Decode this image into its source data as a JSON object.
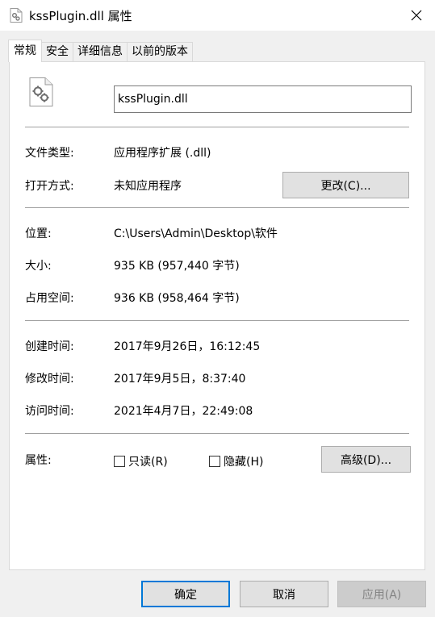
{
  "window": {
    "title": "kssPlugin.dll 属性",
    "icon": "dll-file-icon"
  },
  "tabs": [
    {
      "label": "常规",
      "active": true
    },
    {
      "label": "安全",
      "active": false
    },
    {
      "label": "详细信息",
      "active": false
    },
    {
      "label": "以前的版本",
      "active": false
    }
  ],
  "file": {
    "name": "kssPlugin.dll"
  },
  "fields": {
    "type_label": "文件类型:",
    "type_value": "应用程序扩展 (.dll)",
    "open_label": "打开方式:",
    "open_value": "未知应用程序",
    "change_button": "更改(C)...",
    "location_label": "位置:",
    "location_value": "C:\\Users\\Admin\\Desktop\\软件",
    "size_label": "大小:",
    "size_value": "935 KB (957,440 字节)",
    "disk_label": "占用空间:",
    "disk_value": "936 KB (958,464 字节)",
    "created_label": "创建时间:",
    "created_value": "2017年9月26日，16:12:45",
    "modified_label": "修改时间:",
    "modified_value": "2017年9月5日，8:37:40",
    "accessed_label": "访问时间:",
    "accessed_value": "2021年4月7日，22:49:08",
    "attr_label": "属性:",
    "readonly_label": "只读(R)",
    "readonly_checked": false,
    "hidden_label": "隐藏(H)",
    "hidden_checked": false,
    "advanced_button": "高级(D)..."
  },
  "footer": {
    "ok": "确定",
    "cancel": "取消",
    "apply": "应用(A)"
  },
  "colors": {
    "accent": "#0078d7",
    "window_bg": "#f0f0f0",
    "panel_bg": "#ffffff"
  }
}
